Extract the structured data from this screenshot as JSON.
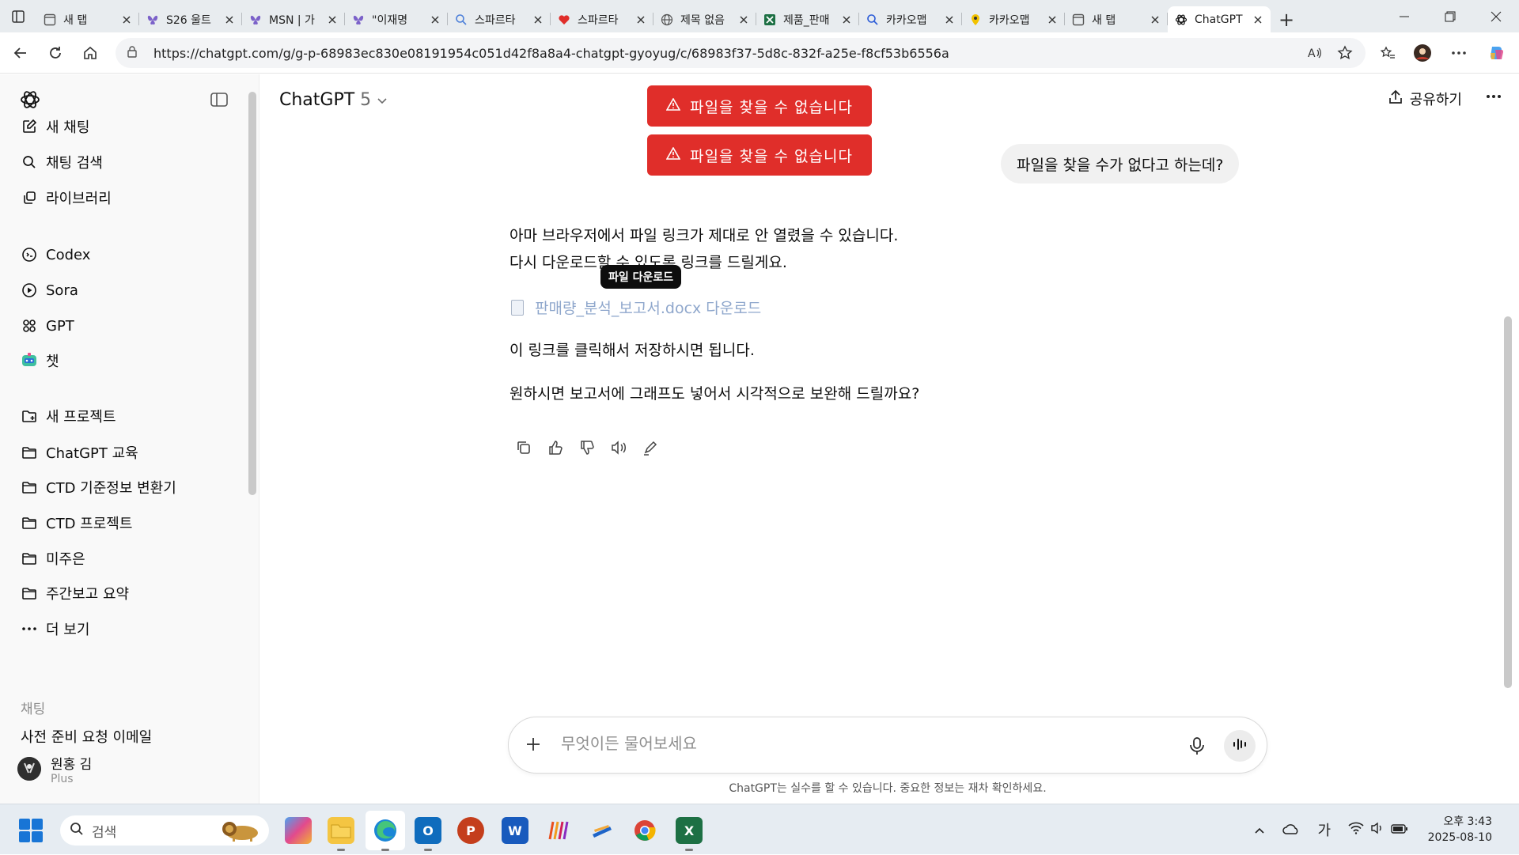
{
  "browser": {
    "tabs": [
      {
        "label": "새 탭",
        "icon": "newtab-icon",
        "color": "#555555"
      },
      {
        "label": "S26 울트",
        "icon": "butterfly-icon",
        "color": "#7b61c9"
      },
      {
        "label": "MSN | 가",
        "icon": "butterfly-icon",
        "color": "#7b61c9"
      },
      {
        "label": "\"이재명",
        "icon": "butterfly-icon",
        "color": "#7b61c9"
      },
      {
        "label": "스파르타",
        "icon": "search-icon",
        "color": "#4c7fd9"
      },
      {
        "label": "스파르타",
        "icon": "heart-icon",
        "color": "#e02e2a"
      },
      {
        "label": "제목 없음",
        "icon": "globe-icon",
        "color": "#555555"
      },
      {
        "label": "제품_판매",
        "icon": "excel-icon",
        "color": "#1d7044"
      },
      {
        "label": "카카오맵",
        "icon": "search-icon",
        "color": "#2a5bd7"
      },
      {
        "label": "카카오맵",
        "icon": "map-pin-icon",
        "color": "#f2c200"
      },
      {
        "label": "새 탭",
        "icon": "newtab-icon",
        "color": "#555555"
      },
      {
        "label": "ChatGPT",
        "icon": "openai-icon",
        "color": "#111111",
        "active": true
      }
    ],
    "new_tab_label": "+",
    "url": "https://chatgpt.com/g/g-p-68983ec830e08191954c051d42f8a8a4-chatgpt-gyoyug/c/68983f37-5d8c-832f-a25e-f8cf53b6556a"
  },
  "sidebar": {
    "items": [
      {
        "label": "새 채팅",
        "icon": "edit-icon"
      },
      {
        "label": "채팅 검색",
        "icon": "search-icon"
      },
      {
        "label": "라이브러리",
        "icon": "library-icon"
      }
    ],
    "apps": [
      {
        "label": "Codex",
        "icon": "codex-icon"
      },
      {
        "label": "Sora",
        "icon": "sora-icon"
      },
      {
        "label": "GPT",
        "icon": "grid-icon"
      },
      {
        "label": "챗",
        "icon": "bot-avatar-icon"
      }
    ],
    "projects": [
      {
        "label": "새 프로젝트",
        "icon": "folder-plus-icon"
      },
      {
        "label": "ChatGPT 교육",
        "icon": "folder-icon"
      },
      {
        "label": "CTD 기준정보 변환기",
        "icon": "folder-icon"
      },
      {
        "label": "CTD 프로젝트",
        "icon": "folder-icon"
      },
      {
        "label": "미주은",
        "icon": "folder-icon"
      },
      {
        "label": "주간보고 요약",
        "icon": "folder-icon"
      },
      {
        "label": "더 보기",
        "icon": "more-icon"
      }
    ],
    "section_chats": "채팅",
    "partial_chat": "사전 준비 요청 이메일",
    "user": {
      "name": "원홍 김",
      "plan": "Plus"
    }
  },
  "header": {
    "model": "ChatGPT",
    "version": "5",
    "share_label": "공유하기"
  },
  "toasts": [
    "파일을 찾을 수 없습니다",
    "파일을 찾을 수 없습니다"
  ],
  "conversation": {
    "user_message": "파일을 찾을 수가 없다고 하는데?",
    "assistant": {
      "line1": "아마 브라우저에서 파일 링크가 제대로 안 열렸을 수 있습니다.",
      "line2": "다시 다운로드할 수 있도록 링크를 드릴게요.",
      "tooltip": "파일 다운로드",
      "link_text": "판매량_분석_보고서.docx 다운로드",
      "line3": "이 링크를 클릭해서 저장하시면 됩니다.",
      "line4": "원하시면 보고서에 그래프도 넣어서 시각적으로 보완해 드릴까요?"
    }
  },
  "composer": {
    "placeholder": "무엇이든 물어보세요",
    "disclaimer": "ChatGPT는 실수를 할 수 있습니다. 중요한 정보는 재차 확인하세요."
  },
  "taskbar": {
    "search_placeholder": "검색",
    "ime": "가",
    "time": "오후 3:43",
    "date": "2025-08-10"
  },
  "colors": {
    "toast": "#e02e2a",
    "link": "#8fa7cc"
  }
}
